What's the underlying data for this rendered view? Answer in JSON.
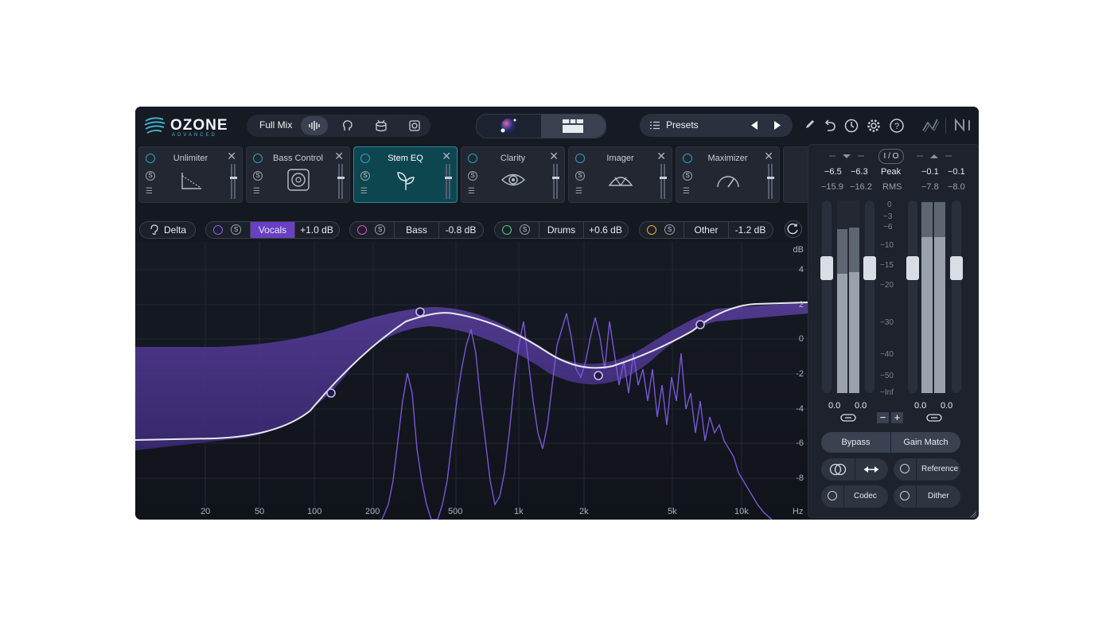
{
  "app": {
    "brand": "OZONE",
    "edition": "ADVANCED"
  },
  "topbar": {
    "mix_label": "Full Mix",
    "presets_label": "Presets",
    "icons": [
      "waveform-icon",
      "vocal-icon",
      "drums-icon",
      "speaker-icon",
      "pencil-icon",
      "undo-icon",
      "history-icon",
      "gear-icon",
      "help-icon",
      "signal-icon",
      "ni-logo"
    ]
  },
  "modules": [
    {
      "name": "Unlimiter",
      "icon": "unlimiter-icon",
      "s": "S"
    },
    {
      "name": "Bass Control",
      "icon": "speaker-icon",
      "s": "S"
    },
    {
      "name": "Stem EQ",
      "icon": "sprout-icon",
      "s": "S"
    },
    {
      "name": "Clarity",
      "icon": "eye-icon",
      "s": "S"
    },
    {
      "name": "Imager",
      "icon": "imager-icon",
      "s": "S"
    },
    {
      "name": "Maximizer",
      "icon": "gauge-icon",
      "s": "S"
    }
  ],
  "stembar": {
    "delta": "Delta",
    "s": "S",
    "stems": [
      {
        "name": "Vocals",
        "value": "+1.0 dB",
        "color": "#8a5cf6"
      },
      {
        "name": "Bass",
        "value": "-0.8 dB",
        "color": "#e04fc4"
      },
      {
        "name": "Drums",
        "value": "+0.6 dB",
        "color": "#4fd18a"
      },
      {
        "name": "Other",
        "value": "-1.2 dB",
        "color": "#f0a93a"
      }
    ]
  },
  "eq": {
    "y_unit": "dB",
    "y_labels": [
      "4",
      "2",
      "0",
      "-2",
      "-4",
      "-6",
      "-8"
    ],
    "x_labels": [
      "20",
      "50",
      "100",
      "200",
      "500",
      "1k",
      "2k",
      "5k",
      "10k",
      "Hz"
    ]
  },
  "meters": {
    "io_label": "I / O",
    "peak_label": "Peak",
    "rms_label": "RMS",
    "in_peak": [
      "−6.5",
      "−6.3"
    ],
    "in_rms": [
      "−15.9",
      "−16.2"
    ],
    "out_peak": [
      "−0.1",
      "−0.1"
    ],
    "out_rms": [
      "−7.8",
      "−8.0"
    ],
    "in_gain": [
      "0.0",
      "0.0"
    ],
    "out_gain": [
      "0.0",
      "0.0"
    ],
    "scale": [
      "0",
      "−3",
      "−6",
      "−10",
      "−15",
      "−20",
      "−30",
      "−40",
      "−50",
      "−Inf"
    ],
    "bypass": "Bypass",
    "gain_match": "Gain Match",
    "reference": "Reference",
    "codec": "Codec",
    "dither": "Dither"
  }
}
